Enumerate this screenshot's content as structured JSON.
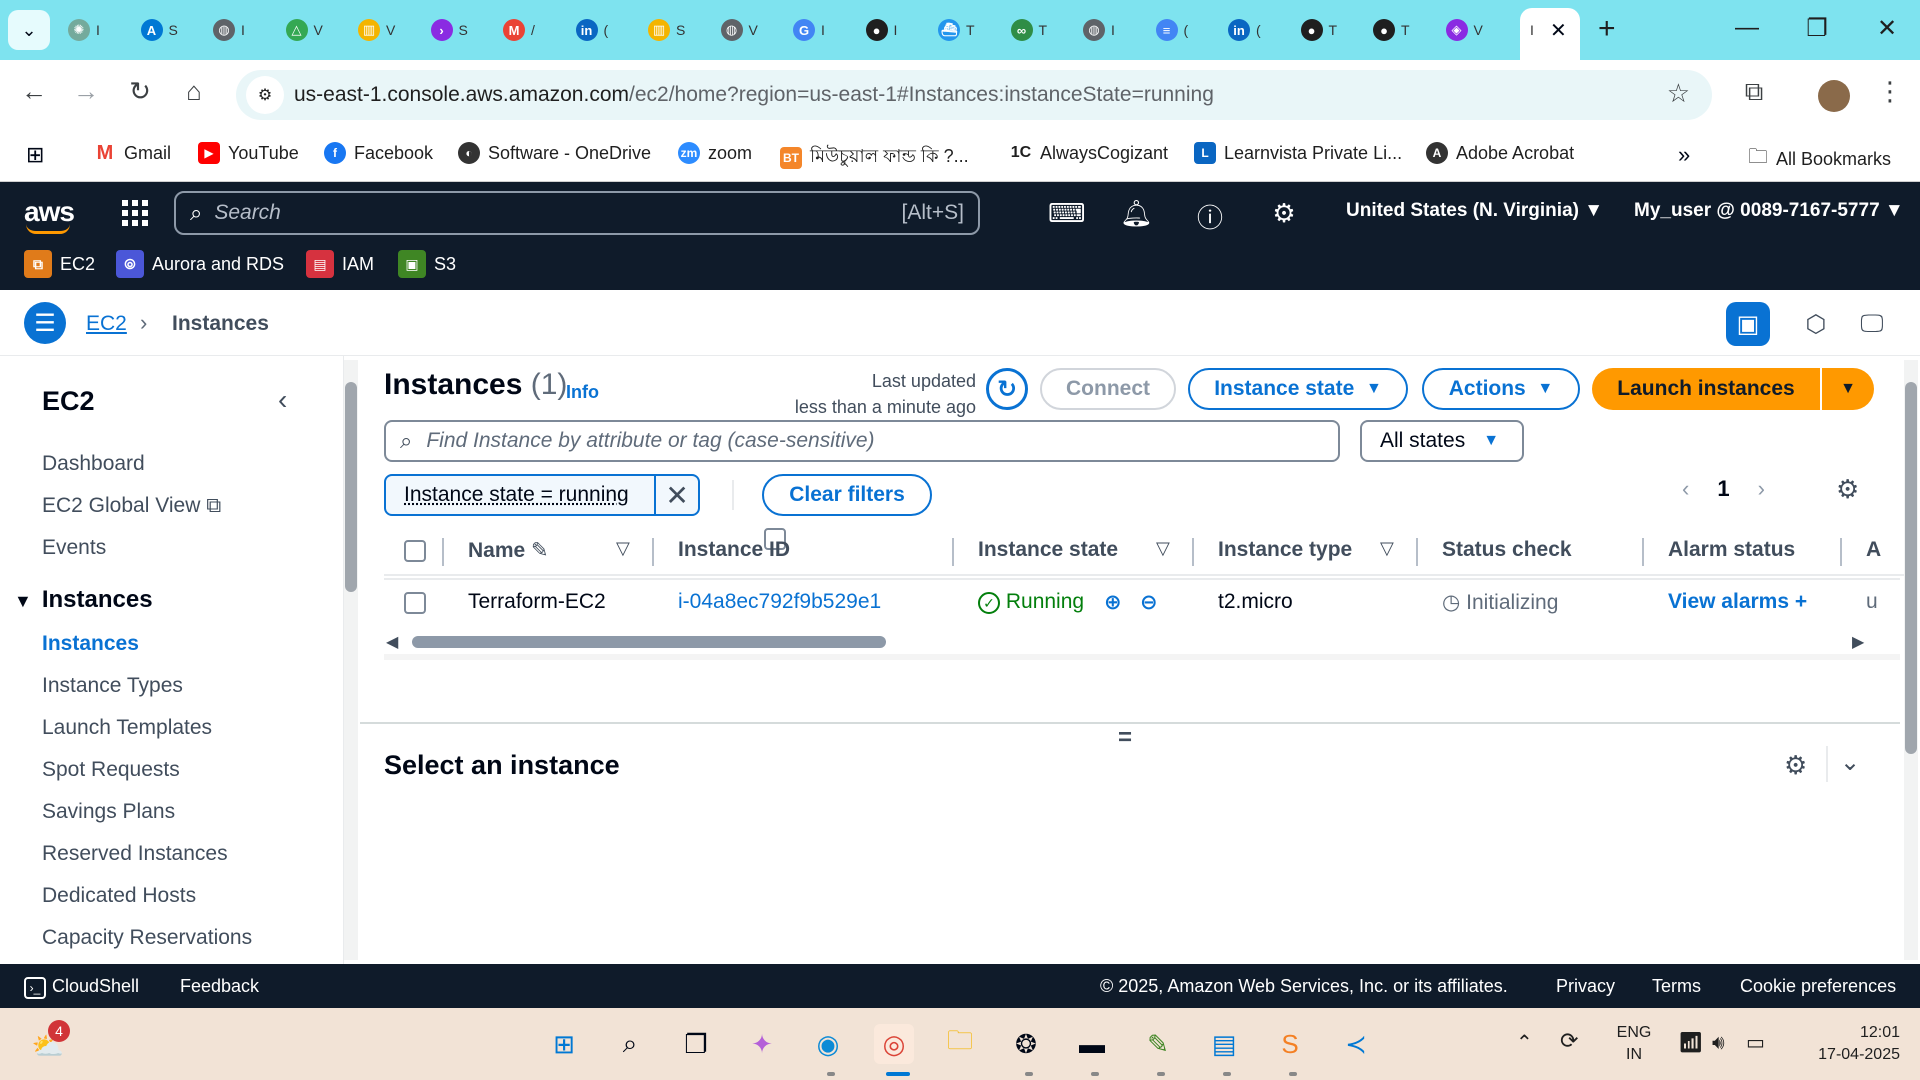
{
  "browser": {
    "tabs": [
      {
        "icon": "chatgpt-icon",
        "label": "I"
      },
      {
        "icon": "azure-icon",
        "label": "S"
      },
      {
        "icon": "globe-icon",
        "label": "I"
      },
      {
        "icon": "google-drive-icon",
        "label": "V"
      },
      {
        "icon": "notes-icon",
        "label": "V"
      },
      {
        "icon": "prime-icon",
        "label": "S"
      },
      {
        "icon": "gmail-icon",
        "label": "/"
      },
      {
        "icon": "linkedin-icon",
        "label": "("
      },
      {
        "icon": "notes-icon",
        "label": "S"
      },
      {
        "icon": "globe-icon",
        "label": "V"
      },
      {
        "icon": "google-icon",
        "label": "I"
      },
      {
        "icon": "github-icon",
        "label": "I"
      },
      {
        "icon": "docker-icon",
        "label": "T"
      },
      {
        "icon": "geeks-icon",
        "label": "T"
      },
      {
        "icon": "globe-icon",
        "label": "I"
      },
      {
        "icon": "docs-icon",
        "label": "("
      },
      {
        "icon": "linkedin-icon",
        "label": "("
      },
      {
        "icon": "github-icon",
        "label": "T"
      },
      {
        "icon": "github-icon",
        "label": "T"
      },
      {
        "icon": "extension-icon",
        "label": "V"
      }
    ],
    "active_tab_label": "I",
    "url_host": "us-east-1.console.aws.amazon.com",
    "url_path": "/ec2/home?region=us-east-1#Instances:instanceState=running"
  },
  "bookmarks": [
    {
      "label": "Gmail",
      "icon": "gmail-icon"
    },
    {
      "label": "YouTube",
      "icon": "youtube-icon"
    },
    {
      "label": "Facebook",
      "icon": "facebook-icon"
    },
    {
      "label": "Software - OneDrive",
      "icon": "onedrive-icon"
    },
    {
      "label": "zoom",
      "icon": "zoom-icon"
    },
    {
      "label": "মিউচুয়াল ফান্ড কি ?...",
      "icon": "bt-icon"
    },
    {
      "label": "AlwaysCogizant",
      "icon": "1c-icon"
    },
    {
      "label": "Learnvista Private Li...",
      "icon": "learnvista-icon"
    },
    {
      "label": "Adobe Acrobat",
      "icon": "acrobat-icon"
    }
  ],
  "bookmarks_all": "All Bookmarks",
  "aws": {
    "search_placeholder": "Search",
    "search_shortcut": "[Alt+S]",
    "region": "United States (N. Virginia)",
    "account": "My_user @ 0089-7167-5777",
    "favorites": [
      "EC2",
      "Aurora and RDS",
      "IAM",
      "S3"
    ]
  },
  "breadcrumb": {
    "root": "EC2",
    "current": "Instances"
  },
  "sidenav": {
    "title": "EC2",
    "top_items": [
      "Dashboard",
      "EC2 Global View",
      "Events"
    ],
    "group": "Instances",
    "group_items": [
      "Instances",
      "Instance Types",
      "Launch Templates",
      "Spot Requests",
      "Savings Plans",
      "Reserved Instances",
      "Dedicated Hosts",
      "Capacity Reservations"
    ]
  },
  "instances": {
    "title": "Instances",
    "count": "(1)",
    "info": "Info",
    "last_updated_1": "Last updated",
    "last_updated_2": "less than a minute ago",
    "connect": "Connect",
    "instance_state_btn": "Instance state",
    "actions_btn": "Actions",
    "launch_btn": "Launch instances",
    "find_placeholder": "Find Instance by attribute or tag (case-sensitive)",
    "states_select": "All states",
    "filter_token": "Instance state = running",
    "clear_filters": "Clear filters",
    "page": "1",
    "columns": [
      "Name",
      "Instance ID",
      "Instance state",
      "Instance type",
      "Status check",
      "Alarm status",
      "A"
    ],
    "row": {
      "name": "Terraform-EC2",
      "id": "i-04a8ec792f9b529e1",
      "state": "Running",
      "type": "t2.micro",
      "status": "Initializing",
      "alarm": "View alarms",
      "extra": "u"
    },
    "select_prompt": "Select an instance"
  },
  "footer": {
    "cloudshell": "CloudShell",
    "feedback": "Feedback",
    "copyright": "© 2025, Amazon Web Services, Inc. or its affiliates.",
    "privacy": "Privacy",
    "terms": "Terms",
    "cookies": "Cookie preferences"
  },
  "taskbar": {
    "weather_badge": "4",
    "lang_1": "ENG",
    "lang_2": "IN",
    "time": "12:01",
    "date": "17-04-2025"
  }
}
